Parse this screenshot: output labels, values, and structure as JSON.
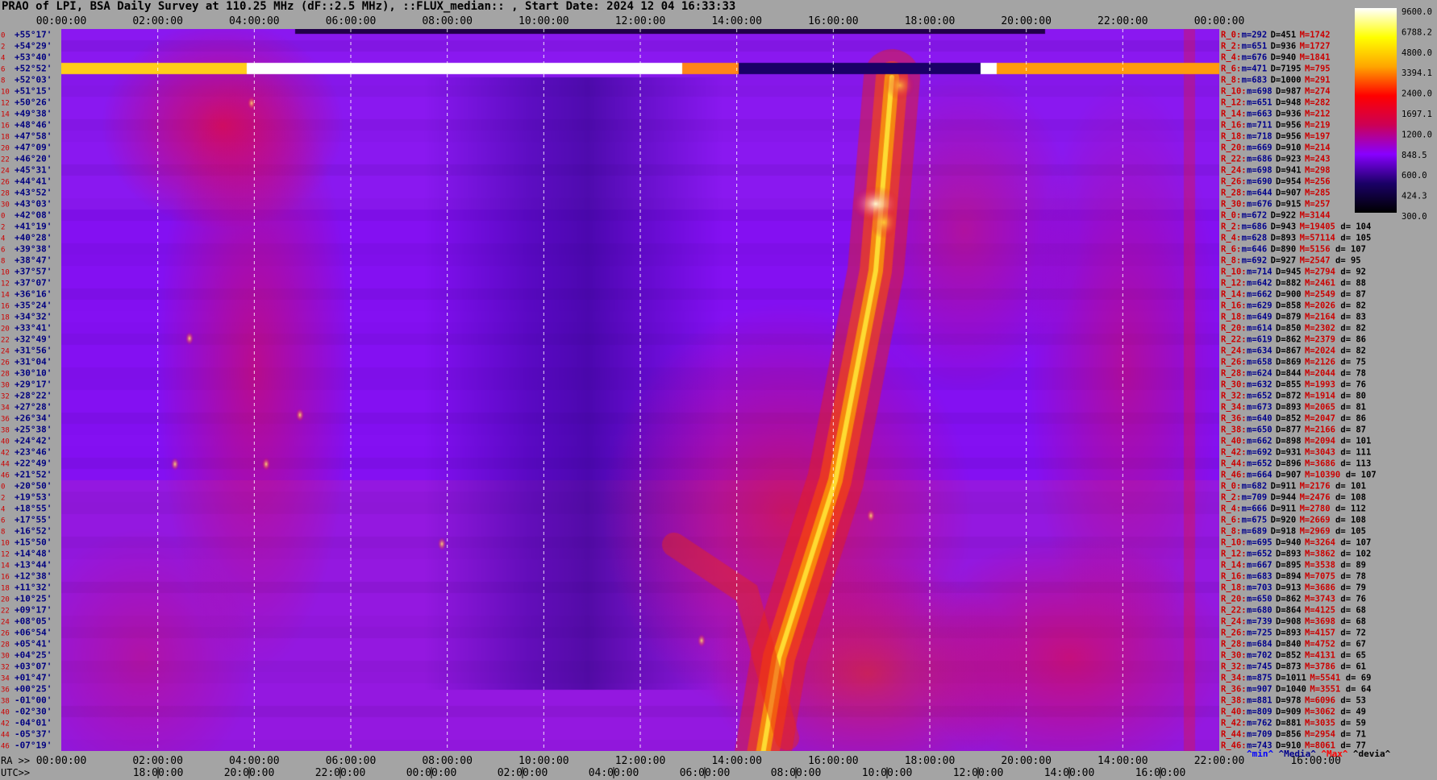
{
  "title": "PRAO of LPI, BSA Daily Survey at 110.25 MHz (dF::2.5 MHz), ::FLUX_median:: , Start Date: 2024 12 04 16:33:33",
  "colors": {
    "background": "#a4a4a4",
    "min_color": "#0000ff",
    "median_color": "#00008b",
    "max_color": "#ff0000",
    "devia_color": "#000000"
  },
  "chart_data": {
    "type": "heatmap",
    "title": "PRAO of LPI, BSA Daily Survey at 110.25 MHz (dF::2.5 MHz), ::FLUX_median:: , Start Date: 2024 12 04 16:33:33",
    "x_top_ticks": [
      "00:00:00",
      "02:00:00",
      "04:00:00",
      "06:00:00",
      "08:00:00",
      "10:00:00",
      "12:00:00",
      "14:00:00",
      "16:00:00",
      "18:00:00",
      "20:00:00",
      "22:00:00",
      "00:00:00"
    ],
    "ra_label": "RA >>",
    "ra_ticks": [
      "00:00:00",
      "02:00:00",
      "04:00:00",
      "06:00:00",
      "08:00:00",
      "10:00:00",
      "12:00:00",
      "14:00:00",
      "16:00:00",
      "18:00:00",
      "20:00:00",
      "14:00:00",
      "22:00:00",
      "16:00:00"
    ],
    "utc_label": "UTC>>",
    "utc_ticks": [
      "18:00:00",
      "20:00:00",
      "22:00:00",
      "00:00:00",
      "02:00:00",
      "04:00:00",
      "06:00:00",
      "08:00:00",
      "10:00:00",
      "12:00:00",
      "14:00:00",
      "16:00:00"
    ],
    "rows": [
      {
        "n": "0",
        "dec": "+55°17'"
      },
      {
        "n": "2",
        "dec": "+54°29'"
      },
      {
        "n": "4",
        "dec": "+53°40'"
      },
      {
        "n": "6",
        "dec": "+52°52'"
      },
      {
        "n": "8",
        "dec": "+52°03'"
      },
      {
        "n": "10",
        "dec": "+51°15'"
      },
      {
        "n": "12",
        "dec": "+50°26'"
      },
      {
        "n": "14",
        "dec": "+49°38'"
      },
      {
        "n": "16",
        "dec": "+48°46'"
      },
      {
        "n": "18",
        "dec": "+47°58'"
      },
      {
        "n": "20",
        "dec": "+47°09'"
      },
      {
        "n": "22",
        "dec": "+46°20'"
      },
      {
        "n": "24",
        "dec": "+45°31'"
      },
      {
        "n": "26",
        "dec": "+44°41'"
      },
      {
        "n": "28",
        "dec": "+43°52'"
      },
      {
        "n": "30",
        "dec": "+43°03'"
      },
      {
        "n": "0",
        "dec": "+42°08'"
      },
      {
        "n": "2",
        "dec": "+41°19'"
      },
      {
        "n": "4",
        "dec": "+40°28'"
      },
      {
        "n": "6",
        "dec": "+39°38'"
      },
      {
        "n": "8",
        "dec": "+38°47'"
      },
      {
        "n": "10",
        "dec": "+37°57'"
      },
      {
        "n": "12",
        "dec": "+37°07'"
      },
      {
        "n": "14",
        "dec": "+36°16'"
      },
      {
        "n": "16",
        "dec": "+35°24'"
      },
      {
        "n": "18",
        "dec": "+34°32'"
      },
      {
        "n": "20",
        "dec": "+33°41'"
      },
      {
        "n": "22",
        "dec": "+32°49'"
      },
      {
        "n": "24",
        "dec": "+31°56'"
      },
      {
        "n": "26",
        "dec": "+31°04'"
      },
      {
        "n": "28",
        "dec": "+30°10'"
      },
      {
        "n": "30",
        "dec": "+29°17'"
      },
      {
        "n": "32",
        "dec": "+28°22'"
      },
      {
        "n": "34",
        "dec": "+27°28'"
      },
      {
        "n": "36",
        "dec": "+26°34'"
      },
      {
        "n": "38",
        "dec": "+25°38'"
      },
      {
        "n": "40",
        "dec": "+24°42'"
      },
      {
        "n": "42",
        "dec": "+23°46'"
      },
      {
        "n": "44",
        "dec": "+22°49'"
      },
      {
        "n": "46",
        "dec": "+21°52'"
      },
      {
        "n": "0",
        "dec": "+20°50'"
      },
      {
        "n": "2",
        "dec": "+19°53'"
      },
      {
        "n": "4",
        "dec": "+18°55'"
      },
      {
        "n": "6",
        "dec": "+17°55'"
      },
      {
        "n": "8",
        "dec": "+16°52'"
      },
      {
        "n": "10",
        "dec": "+15°50'"
      },
      {
        "n": "12",
        "dec": "+14°48'"
      },
      {
        "n": "14",
        "dec": "+13°44'"
      },
      {
        "n": "16",
        "dec": "+12°38'"
      },
      {
        "n": "18",
        "dec": "+11°32'"
      },
      {
        "n": "20",
        "dec": "+10°25'"
      },
      {
        "n": "22",
        "dec": "+09°17'"
      },
      {
        "n": "24",
        "dec": "+08°05'"
      },
      {
        "n": "26",
        "dec": "+06°54'"
      },
      {
        "n": "28",
        "dec": "+05°41'"
      },
      {
        "n": "30",
        "dec": "+04°25'"
      },
      {
        "n": "32",
        "dec": "+03°07'"
      },
      {
        "n": "34",
        "dec": "+01°47'"
      },
      {
        "n": "36",
        "dec": "+00°25'"
      },
      {
        "n": "38",
        "dec": "-01°00'"
      },
      {
        "n": "40",
        "dec": "-02°30'"
      },
      {
        "n": "42",
        "dec": "-04°01'"
      },
      {
        "n": "44",
        "dec": "-05°37'"
      },
      {
        "n": "46",
        "dec": "-07°19'"
      }
    ],
    "stats": [
      {
        "r": "R_0:",
        "min": "292",
        "med": "451",
        "max": "1742",
        "d": ""
      },
      {
        "r": "R_2:",
        "min": "651",
        "med": "936",
        "max": "1727",
        "d": ""
      },
      {
        "r": "R_4:",
        "min": "676",
        "med": "940",
        "max": "1841",
        "d": ""
      },
      {
        "r": "R_6:",
        "min": "471",
        "med": "7195",
        "max": "795",
        "d": ""
      },
      {
        "r": "R_8:",
        "min": "683",
        "med": "1000",
        "max": "291",
        "d": ""
      },
      {
        "r": "R_10:",
        "min": "698",
        "med": "987",
        "max": "274",
        "d": ""
      },
      {
        "r": "R_12:",
        "min": "651",
        "med": "948",
        "max": "282",
        "d": ""
      },
      {
        "r": "R_14:",
        "min": "663",
        "med": "936",
        "max": "212",
        "d": ""
      },
      {
        "r": "R_16:",
        "min": "711",
        "med": "956",
        "max": "219",
        "d": ""
      },
      {
        "r": "R_18:",
        "min": "718",
        "med": "956",
        "max": "197",
        "d": ""
      },
      {
        "r": "R_20:",
        "min": "669",
        "med": "910",
        "max": "214",
        "d": ""
      },
      {
        "r": "R_22:",
        "min": "686",
        "med": "923",
        "max": "243",
        "d": ""
      },
      {
        "r": "R_24:",
        "min": "698",
        "med": "941",
        "max": "298",
        "d": ""
      },
      {
        "r": "R_26:",
        "min": "690",
        "med": "954",
        "max": "256",
        "d": ""
      },
      {
        "r": "R_28:",
        "min": "644",
        "med": "907",
        "max": "285",
        "d": ""
      },
      {
        "r": "R_30:",
        "min": "676",
        "med": "915",
        "max": "257",
        "d": ""
      },
      {
        "r": "R_0:",
        "min": "672",
        "med": "922",
        "max": "3144",
        "d": ""
      },
      {
        "r": "R_2:",
        "min": "686",
        "med": "943",
        "max": "19405",
        "d": "104"
      },
      {
        "r": "R_4:",
        "min": "628",
        "med": "893",
        "max": "57114",
        "d": "105"
      },
      {
        "r": "R_6:",
        "min": "646",
        "med": "890",
        "max": "5156",
        "d": "107"
      },
      {
        "r": "R_8:",
        "min": "692",
        "med": "927",
        "max": "2547",
        "d": "95"
      },
      {
        "r": "R_10:",
        "min": "714",
        "med": "945",
        "max": "2794",
        "d": "92"
      },
      {
        "r": "R_12:",
        "min": "642",
        "med": "882",
        "max": "2461",
        "d": "88"
      },
      {
        "r": "R_14:",
        "min": "662",
        "med": "900",
        "max": "2549",
        "d": "87"
      },
      {
        "r": "R_16:",
        "min": "629",
        "med": "858",
        "max": "2026",
        "d": "82"
      },
      {
        "r": "R_18:",
        "min": "649",
        "med": "879",
        "max": "2164",
        "d": "83"
      },
      {
        "r": "R_20:",
        "min": "614",
        "med": "850",
        "max": "2302",
        "d": "82"
      },
      {
        "r": "R_22:",
        "min": "619",
        "med": "862",
        "max": "2379",
        "d": "86"
      },
      {
        "r": "R_24:",
        "min": "634",
        "med": "867",
        "max": "2024",
        "d": "82"
      },
      {
        "r": "R_26:",
        "min": "658",
        "med": "869",
        "max": "2126",
        "d": "75"
      },
      {
        "r": "R_28:",
        "min": "624",
        "med": "844",
        "max": "2044",
        "d": "78"
      },
      {
        "r": "R_30:",
        "min": "632",
        "med": "855",
        "max": "1993",
        "d": "76"
      },
      {
        "r": "R_32:",
        "min": "652",
        "med": "872",
        "max": "1914",
        "d": "80"
      },
      {
        "r": "R_34:",
        "min": "673",
        "med": "893",
        "max": "2065",
        "d": "81"
      },
      {
        "r": "R_36:",
        "min": "640",
        "med": "852",
        "max": "2047",
        "d": "86"
      },
      {
        "r": "R_38:",
        "min": "650",
        "med": "877",
        "max": "2166",
        "d": "87"
      },
      {
        "r": "R_40:",
        "min": "662",
        "med": "898",
        "max": "2094",
        "d": "101"
      },
      {
        "r": "R_42:",
        "min": "692",
        "med": "931",
        "max": "3043",
        "d": "111"
      },
      {
        "r": "R_44:",
        "min": "652",
        "med": "896",
        "max": "3686",
        "d": "113"
      },
      {
        "r": "R_46:",
        "min": "664",
        "med": "907",
        "max": "10390",
        "d": "107"
      },
      {
        "r": "R_0:",
        "min": "682",
        "med": "911",
        "max": "2176",
        "d": "101"
      },
      {
        "r": "R_2:",
        "min": "709",
        "med": "944",
        "max": "2476",
        "d": "108"
      },
      {
        "r": "R_4:",
        "min": "666",
        "med": "911",
        "max": "2780",
        "d": "112"
      },
      {
        "r": "R_6:",
        "min": "675",
        "med": "920",
        "max": "2669",
        "d": "108"
      },
      {
        "r": "R_8:",
        "min": "689",
        "med": "918",
        "max": "2969",
        "d": "105"
      },
      {
        "r": "R_10:",
        "min": "695",
        "med": "940",
        "max": "3264",
        "d": "107"
      },
      {
        "r": "R_12:",
        "min": "652",
        "med": "893",
        "max": "3862",
        "d": "102"
      },
      {
        "r": "R_14:",
        "min": "667",
        "med": "895",
        "max": "3538",
        "d": "89"
      },
      {
        "r": "R_16:",
        "min": "683",
        "med": "894",
        "max": "7075",
        "d": "78"
      },
      {
        "r": "R_18:",
        "min": "703",
        "med": "913",
        "max": "3686",
        "d": "79"
      },
      {
        "r": "R_20:",
        "min": "650",
        "med": "862",
        "max": "3743",
        "d": "76"
      },
      {
        "r": "R_22:",
        "min": "680",
        "med": "864",
        "max": "4125",
        "d": "68"
      },
      {
        "r": "R_24:",
        "min": "739",
        "med": "908",
        "max": "3698",
        "d": "68"
      },
      {
        "r": "R_26:",
        "min": "725",
        "med": "893",
        "max": "4157",
        "d": "72"
      },
      {
        "r": "R_28:",
        "min": "684",
        "med": "840",
        "max": "4752",
        "d": "67"
      },
      {
        "r": "R_30:",
        "min": "702",
        "med": "852",
        "max": "4131",
        "d": "65"
      },
      {
        "r": "R_32:",
        "min": "745",
        "med": "873",
        "max": "3786",
        "d": "61"
      },
      {
        "r": "R_34:",
        "min": "875",
        "med": "1011",
        "max": "5541",
        "d": "69"
      },
      {
        "r": "R_36:",
        "min": "907",
        "med": "1040",
        "max": "3551",
        "d": "64"
      },
      {
        "r": "R_38:",
        "min": "881",
        "med": "978",
        "max": "6096",
        "d": "53"
      },
      {
        "r": "R_40:",
        "min": "809",
        "med": "909",
        "max": "3062",
        "d": "49"
      },
      {
        "r": "R_42:",
        "min": "762",
        "med": "881",
        "max": "3035",
        "d": "59"
      },
      {
        "r": "R_44:",
        "min": "709",
        "med": "856",
        "max": "2954",
        "d": "71"
      },
      {
        "r": "R_46:",
        "min": "743",
        "med": "910",
        "max": "8061",
        "d": "77"
      }
    ],
    "colorbar": {
      "tick_labels": [
        "9600.0",
        "6788.2",
        "4800.0",
        "3394.1",
        "2400.0",
        "1697.1",
        "1200.0",
        "848.5",
        "600.0",
        "424.3",
        "300.0"
      ],
      "range": [
        300.0,
        9600.0
      ],
      "scale": "log",
      "stops": [
        "#ffffff",
        "#ffff00",
        "#ffa500",
        "#ff0000",
        "#cc0055",
        "#8800ff",
        "#1a0066",
        "#000000"
      ]
    },
    "footer": [
      "^min^",
      "^Media^",
      "^Max^",
      "^devia^"
    ]
  }
}
